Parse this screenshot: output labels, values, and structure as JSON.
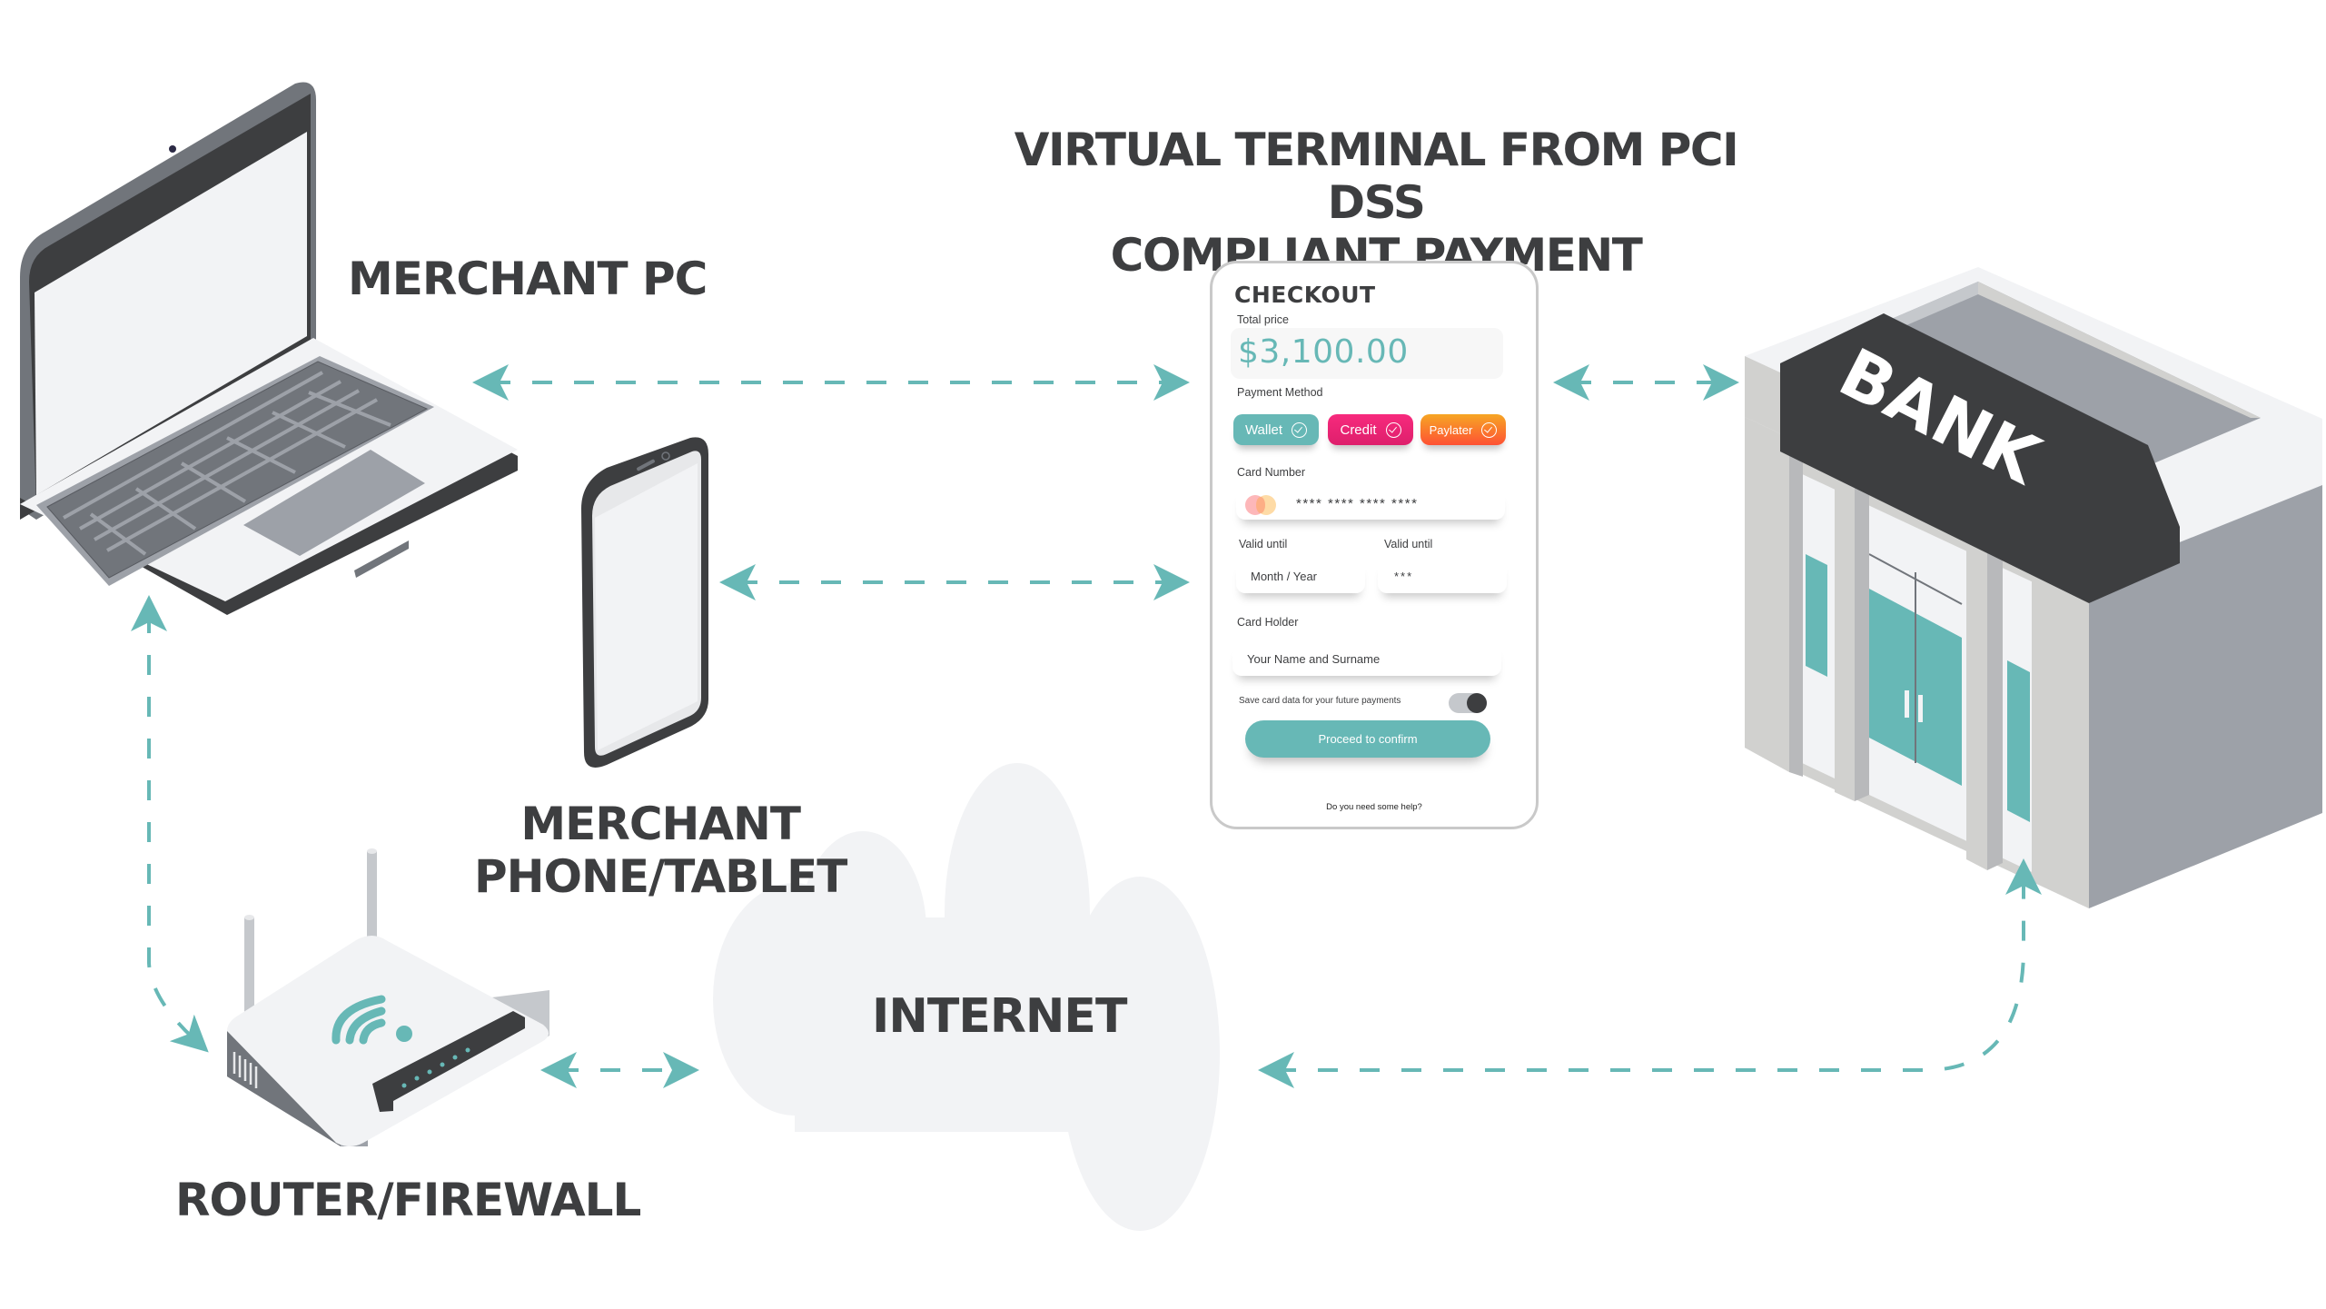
{
  "title": {
    "line1": "VIRTUAL TERMINAL FROM PCI DSS",
    "line2": "COMPLIANT PAYMENT PROCESSOR"
  },
  "nodes": {
    "merchant_pc": {
      "label": "MERCHANT PC",
      "icon": "laptop-icon"
    },
    "merchant_phone": {
      "label_line1": "MERCHANT",
      "label_line2": "PHONE/TABLET",
      "icon": "smartphone-icon"
    },
    "router": {
      "label": "ROUTER/FIREWALL",
      "icon": "wifi-router-icon"
    },
    "internet": {
      "label": "INTERNET",
      "icon": "cloud-icon"
    },
    "bank": {
      "label": "BANK",
      "icon": "bank-building-icon"
    }
  },
  "connections": [
    {
      "from": "merchant_pc",
      "to": "virtual_terminal",
      "style": "dashed",
      "arrows": "both"
    },
    {
      "from": "merchant_phone",
      "to": "virtual_terminal",
      "style": "dashed",
      "arrows": "both"
    },
    {
      "from": "virtual_terminal",
      "to": "bank",
      "style": "dashed",
      "arrows": "both"
    },
    {
      "from": "merchant_pc",
      "to": "router",
      "style": "dashed",
      "arrows": "both"
    },
    {
      "from": "router",
      "to": "internet",
      "style": "dashed",
      "arrows": "both"
    },
    {
      "from": "internet",
      "to": "bank",
      "style": "dashed",
      "arrows": "both"
    }
  ],
  "checkout": {
    "title": "CHECKOUT",
    "total_label": "Total price",
    "total_value": "$3,100.00",
    "payment_method_label": "Payment Method",
    "payment_methods": [
      {
        "label": "Wallet",
        "color": "#67b8b6"
      },
      {
        "label": "Credit",
        "color": "#ec2474"
      },
      {
        "label": "Paylater",
        "color": "#fa7a2c"
      }
    ],
    "card_number_label": "Card Number",
    "card_number_value": "**** **** **** ****",
    "valid_until_label_1": "Valid until",
    "valid_until_placeholder": "Month / Year",
    "valid_until_label_2": "Valid until",
    "cvv_value": "***",
    "card_holder_label": "Card Holder",
    "card_holder_placeholder": "Your Name and Surname",
    "save_card_label": "Save card data for your future payments",
    "save_card_enabled": true,
    "proceed_label": "Proceed to confirm",
    "help_label": "Do you need some help?"
  },
  "colors": {
    "accent": "#67b8b6",
    "text": "#3d3e40",
    "device_dark": "#3d3e40",
    "device_light": "#f2f3f5",
    "cloud": "#f2f3f5"
  }
}
